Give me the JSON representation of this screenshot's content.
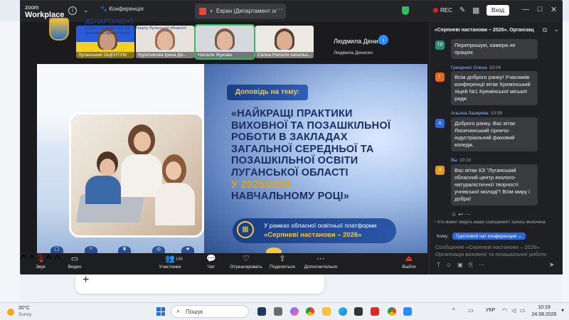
{
  "window": {
    "logo_top": "zoom",
    "logo_bottom": "Workplace",
    "conference_tab": "Конференція",
    "screen_tab": "Екран (Департамент освіти",
    "rec_label": "REC",
    "signin_label": "Вход"
  },
  "participants": [
    {
      "name": "Луганський ОЦЕНТУМ"
    },
    {
      "name": "Курятнікова Ірина Де..."
    },
    {
      "name": "Наталія Жукова"
    },
    {
      "name": "Сапна Наталія начальн..."
    }
  ],
  "overflow_participant": {
    "name": "Людмила Дени...",
    "subname": "Людмила Дениско"
  },
  "slide": {
    "dept_title": "ДЕПАРТАМЕНТ",
    "dept_sub": "освіти, культури, молоді та спорту Луганської обласної державної адміністрації",
    "report_label": "Доповідь на тему:",
    "headline_main": "«НАЙКРАЩІ ПРАКТИКИ ВИХОВНОЇ ТА ПОЗАШКІЛЬНОЇ РОБОТИ В ЗАКЛАДАХ ЗАГАЛЬНОЇ СЕРЕДНЬОЇ ТА ПОЗАШКІЛЬНОЇ ОСВІТИ ЛУГАНСЬКОЇ ОБЛАСТІ",
    "headline_year": "У 2025/2026",
    "headline_end": "НАВЧАЛЬНОМУ РОЦІ»",
    "platform_line1": "У рамках обласної освітньої платформи",
    "platform_line2": "«Серпневі настанови – 2026»"
  },
  "toolbar": {
    "audio": "Звук",
    "video": "Видео",
    "participants": "Участники",
    "participants_count": "169",
    "chat": "Чат",
    "react": "Отреагировать",
    "share": "Поделиться",
    "more": "Дополнительно",
    "leave": "Выйти"
  },
  "chat": {
    "title": "«Серпневі настанови – 2026». Організація в...",
    "messages": [
      {
        "initials": "TP",
        "color": "#2a8a72",
        "sender": "",
        "time": "",
        "text": "Перепрошую, камера не працює"
      },
      {
        "initials": "Г",
        "color": "#e06a22",
        "sender": "Грищенко Олена",
        "time": "10:04",
        "text": "Всім доброго ранку! Учасників конференції вітає Кремінський ліцей №1 Кремінської міської ради"
      },
      {
        "initials": "А",
        "color": "#2d68d8",
        "sender": "Альона Лазарева",
        "time": "10:09",
        "text": "Доброго ранку. Вас вітає Лисичанський гірничо-індустріальний фаховий коледж."
      },
      {
        "initials": "Л",
        "color": "#e09a22",
        "sender": "Вы",
        "time": "10:10",
        "text": "Вас вітає КЗ \"Луганський обласний центр еколого-натуралістичної творчості учнівської молоді\"! Всім миру і добра!"
      }
    ],
    "notice": "Кто может видеть ваши сообщения? Запись включена",
    "to_label": "Кому:",
    "to_value": "Групповой чат конференции",
    "input_placeholder": "Сообщение «Серпневі настанови – 2026». Організація виховної та позашкільної роботи"
  },
  "taskbar": {
    "temp": "20°C",
    "weather": "Sunny",
    "search": "Пошук",
    "lang": "УКР",
    "time": "10:19",
    "date": "24.08.2026"
  }
}
